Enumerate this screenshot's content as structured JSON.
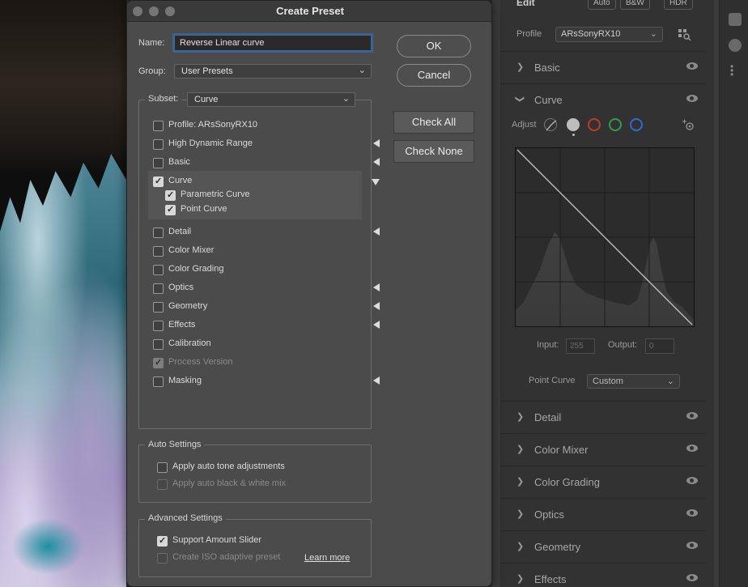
{
  "dialog": {
    "title": "Create Preset",
    "name_label": "Name:",
    "name_value": "Reverse Linear curve",
    "group_label": "Group:",
    "group_value": "User Presets",
    "subset_label": "Subset:",
    "subset_value": "Curve",
    "ok_label": "OK",
    "cancel_label": "Cancel",
    "check_all_label": "Check All",
    "check_none_label": "Check None",
    "items": [
      {
        "label": "Profile: ARsSonyRX10",
        "checked": false,
        "disabled": false,
        "arrow": ""
      },
      {
        "label": "High Dynamic Range",
        "checked": false,
        "disabled": false,
        "arrow": "left"
      },
      {
        "label": "Basic",
        "checked": false,
        "disabled": false,
        "arrow": "left"
      },
      {
        "label": "Curve",
        "checked": true,
        "disabled": false,
        "arrow": "down"
      },
      {
        "label": "Parametric Curve",
        "checked": true,
        "disabled": false,
        "arrow": ""
      },
      {
        "label": "Point Curve",
        "checked": true,
        "disabled": false,
        "arrow": ""
      },
      {
        "label": "Detail",
        "checked": false,
        "disabled": false,
        "arrow": "left"
      },
      {
        "label": "Color Mixer",
        "checked": false,
        "disabled": false,
        "arrow": ""
      },
      {
        "label": "Color Grading",
        "checked": false,
        "disabled": false,
        "arrow": ""
      },
      {
        "label": "Optics",
        "checked": false,
        "disabled": false,
        "arrow": "left"
      },
      {
        "label": "Geometry",
        "checked": false,
        "disabled": false,
        "arrow": "left"
      },
      {
        "label": "Effects",
        "checked": false,
        "disabled": false,
        "arrow": "left"
      },
      {
        "label": "Calibration",
        "checked": false,
        "disabled": false,
        "arrow": ""
      },
      {
        "label": "Process Version",
        "checked": true,
        "disabled": true,
        "arrow": ""
      },
      {
        "label": "Masking",
        "checked": false,
        "disabled": false,
        "arrow": "left"
      }
    ],
    "auto_settings": {
      "title": "Auto Settings",
      "tone_label": "Apply auto tone adjustments",
      "tone_checked": false,
      "bw_label": "Apply auto black & white mix",
      "bw_checked": false
    },
    "advanced_settings": {
      "title": "Advanced Settings",
      "amount_label": "Support Amount Slider",
      "amount_checked": true,
      "iso_label": "Create ISO adaptive preset",
      "iso_checked": false,
      "learn_more": "Learn more"
    }
  },
  "right_panel": {
    "edit_label": "Edit",
    "auto_btn": "Auto",
    "bw_btn": "B&W",
    "hdr_btn": "HDR",
    "profile_label": "Profile",
    "profile_value": "ARsSonyRX10",
    "sections_top": [
      "Basic",
      "Curve"
    ],
    "adjust_label": "Adjust",
    "input_label": "Input:",
    "input_value": "255",
    "output_label": "Output:",
    "output_value": "0",
    "point_curve_label": "Point Curve",
    "point_curve_value": "Custom",
    "sections_bottom": [
      "Detail",
      "Color Mixer",
      "Color Grading",
      "Optics",
      "Geometry",
      "Effects"
    ]
  },
  "colors": {
    "dialog_bg": "#4b4b4b",
    "panel_bg": "#323232",
    "focus_ring": "#3875bd",
    "curve_red": "#c0392b",
    "curve_green": "#2e9e47",
    "curve_blue": "#2e6bd0"
  }
}
